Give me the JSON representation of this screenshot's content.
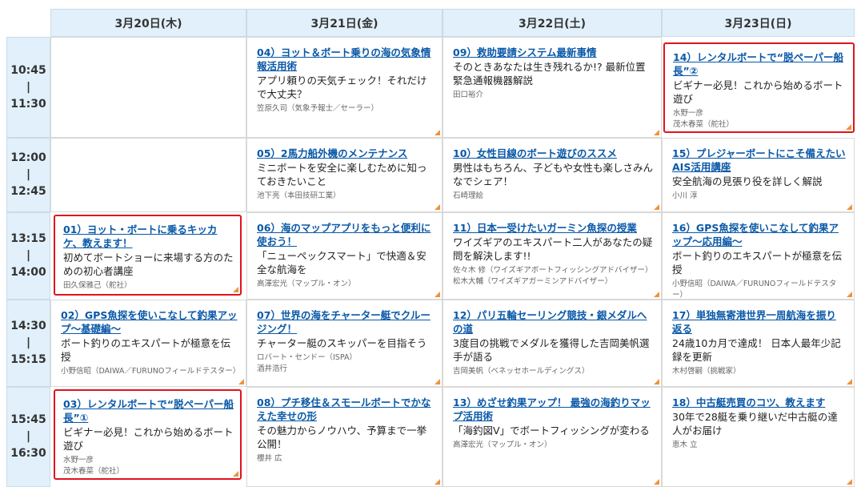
{
  "days": [
    "3月20日(木)",
    "3月21日(金)",
    "3月22日(土)",
    "3月23日(日)"
  ],
  "times": [
    {
      "start": "10:45",
      "sep": "|",
      "end": "11:30"
    },
    {
      "start": "12:00",
      "sep": "|",
      "end": "12:45"
    },
    {
      "start": "13:15",
      "sep": "|",
      "end": "14:00"
    },
    {
      "start": "14:30",
      "sep": "|",
      "end": "15:15"
    },
    {
      "start": "15:45",
      "sep": "|",
      "end": "16:30"
    }
  ],
  "sessions": {
    "s04": {
      "title": "04）ヨット＆ボート乗りの海の気象情報活用術",
      "desc": "アプリ頼りの天気チェック！それだけで大丈夫？",
      "speakers": [
        "笠原久司（気象予報士／セーラー）"
      ]
    },
    "s09": {
      "title": "09）救助要請システム最新事情",
      "desc": "そのときあなたは生き残れるか!? 最新位置 緊急通報機器解説",
      "speakers": [
        "田口裕介"
      ]
    },
    "s14": {
      "title": "14）レンタルボートで“脱ペーパー船長”②",
      "desc": "ビギナー必見！これから始めるボート遊び",
      "speakers": [
        "水野一彦",
        "茂木春菜（舵社）"
      ]
    },
    "s05": {
      "title": "05）2馬力船外機のメンテナンス",
      "desc": "ミニボートを安全に楽しむために知っておきたいこと",
      "speakers": [
        "池下亮（本田技研工業）"
      ]
    },
    "s10": {
      "title": "10）女性目線のボート遊びのススメ",
      "desc": "男性はもちろん、子どもや女性も楽しさみんなでシェア！",
      "speakers": [
        "石崎理絵"
      ]
    },
    "s15": {
      "title": "15）プレジャーボートにこそ備えたいAIS活用講座",
      "desc": "安全航海の見張り役を詳しく解説",
      "speakers": [
        "小川 淳"
      ]
    },
    "s01": {
      "title": "01）ヨット・ボートに乗るキッカケ、教えます！",
      "desc": "初めてボートショーに来場する方のための初心者講座",
      "speakers": [
        "田久保雅己（舵社）"
      ]
    },
    "s06": {
      "title": "06）海のマップアプリをもっと便利に使おう！",
      "desc": "「ニューペックスマート」で快適＆安全な航海を",
      "speakers": [
        "高澤宏光（マップル・オン）"
      ]
    },
    "s11": {
      "title": "11）日本一受けたいガーミン魚探の授業",
      "desc": "ワイズギアのエキスパート二人があなたの疑問を解決します!!",
      "speakers": [
        "佐々木 修（ワイズギアボートフィッシングアドバイザー）",
        "松木大輔（ワイズギアガーミンアドバイザー）"
      ]
    },
    "s16": {
      "title": "16）GPS魚探を使いこなして釣果アップ〜応用編〜",
      "desc": "ボート釣りのエキスパートが極意を伝授",
      "speakers": [
        "小野信昭（DAIWA／FURUNOフィールドテスター）"
      ]
    },
    "s02": {
      "title": "02）GPS魚探を使いこなして釣果アップ〜基礎編〜",
      "desc": "ボート釣りのエキスパートが極意を伝授",
      "speakers": [
        "小野信昭（DAIWA／FURUNOフィールドテスター）"
      ]
    },
    "s07": {
      "title": "07）世界の海をチャーター艇でクルージング！",
      "desc": "チャーター艇のスキッパーを目指そう",
      "speakers": [
        "ロバート・センドー（ISPA）",
        "酒井浩行"
      ]
    },
    "s12": {
      "title": "12）パリ五輪セーリング競技・銀メダルへの道",
      "desc": "3度目の挑戦でメダルを獲得した吉岡美帆選手が語る",
      "speakers": [
        "吉岡美帆（ベネッセホールディングス）"
      ]
    },
    "s17": {
      "title": "17）単独無寄港世界一周航海を振り返る",
      "desc": "24歳10カ月で達成！ 日本人最年少記録を更新",
      "speakers": [
        "木村啓嗣（挑戦家）"
      ]
    },
    "s03": {
      "title": "03）レンタルボートで“脱ペーパー船長”①",
      "desc": "ビギナー必見！これから始めるボート遊び",
      "speakers": [
        "水野一彦",
        "茂木春菜（舵社）"
      ]
    },
    "s08": {
      "title": "08）プチ移住＆スモールボートでかなえた幸せの形",
      "desc": "その魅力からノウハウ、予算まで一挙公開！",
      "speakers": [
        "櫻井 広"
      ]
    },
    "s13": {
      "title": "13）めざせ釣果アップ！ 最強の海釣りマップ活用術",
      "desc": "「海釣図V」でボートフィッシングが変わる",
      "speakers": [
        "高澤宏光（マップル・オン）"
      ]
    },
    "s18": {
      "title": "18）中古艇売買のコツ、教えます",
      "desc": "30年で28艇を乗り継いだ中古艇の達人がお届け",
      "speakers": [
        "恵木 立"
      ]
    }
  },
  "colors": {
    "header_bg": "#e1f0fa",
    "link": "#0a59a8",
    "highlight_border": "#e0141e",
    "corner_marker": "#f0923a"
  }
}
